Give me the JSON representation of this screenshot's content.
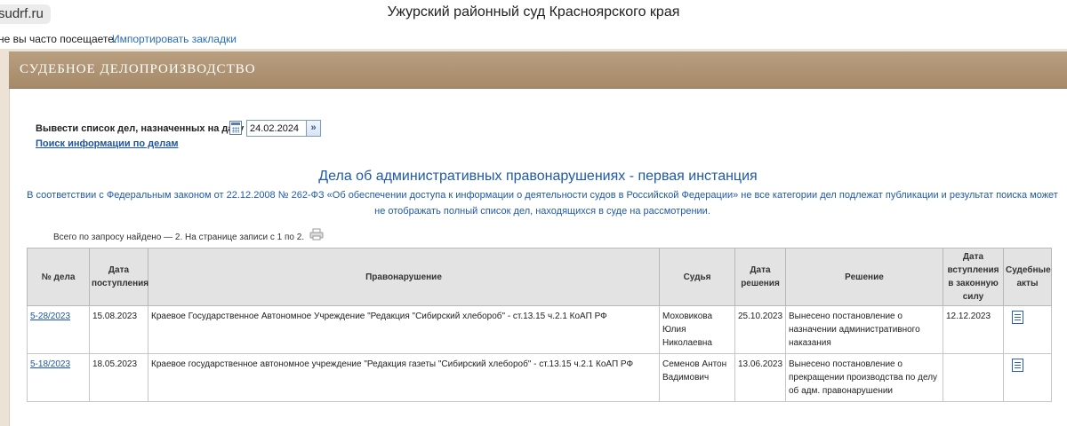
{
  "browser": {
    "url_chip": "sudrf.ru",
    "window_title": "Ужурский районный суд Красноярского края",
    "bookmarks_text": "не вы часто посещаете.",
    "bookmarks_link": "Импортировать закладки"
  },
  "banner": {
    "title": "СУДЕБНОЕ ДЕЛОПРОИЗВОДСТВО"
  },
  "form": {
    "date_label": "Вывести список дел, назначенных на дату",
    "date_value": "24.02.2024",
    "go_label": "»",
    "search_link": "Поиск информации по делам"
  },
  "heading": "Дела об административных правонарушениях - первая инстанция",
  "notice": "В соответствии с Федеральным законом от 22.12.2008 № 262-ФЗ «Об обеспечении доступа к информации о деятельности судов в Российской Федерации» не все категории дел подлежат публикации и результат поиска может не отображать полный список дел, находящихся в суде на рассмотрении.",
  "summary": "Всего по запросу найдено — 2. На странице записи с 1 по 2.",
  "table": {
    "headers": {
      "num": "№ дела",
      "received": "Дата поступления",
      "offense": "Правонарушение",
      "judge": "Судья",
      "decision_date": "Дата решения",
      "decision": "Решение",
      "effective": "Дата вступления в законную силу",
      "acts": "Судебные акты"
    },
    "rows": [
      {
        "num": "5-28/2023",
        "received": "15.08.2023",
        "offense": "Краевое Государственное Автономное Учреждение \"Редакция \"Сибирский хлебороб\" - ст.13.15 ч.2.1 КоАП РФ",
        "judge": "Моховикова Юлия Николаевна",
        "decision_date": "25.10.2023",
        "decision": "Вынесено постановление о назначении административного наказания",
        "effective": "12.12.2023",
        "acts_icon": "document-icon"
      },
      {
        "num": "5-18/2023",
        "received": "18.05.2023",
        "offense": "Краевое государственное автономное учреждение \"Редакция газеты \"Сибирский хлебороб\" - ст.13.15 ч.2.1 КоАП РФ",
        "judge": "Семенов Антон Вадимович",
        "decision_date": "13.06.2023",
        "decision": "Вынесено постановление о прекращении производства по делу об адм. правонарушении",
        "effective": "",
        "acts_icon": "document-icon"
      }
    ]
  },
  "colors": {
    "banner": "#a68a69",
    "link": "#1f56a3",
    "heading": "#1f5aa6",
    "page_bg": "#ece2d6"
  }
}
